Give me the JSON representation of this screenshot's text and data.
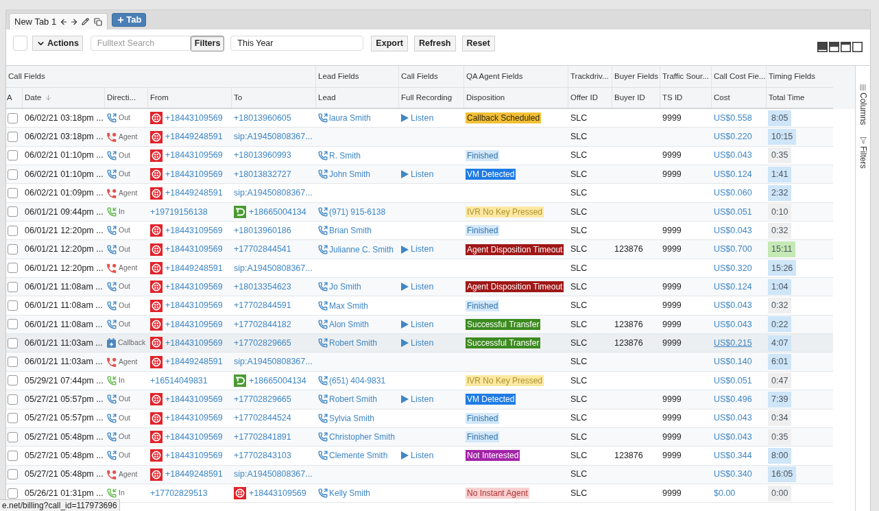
{
  "tabs": [
    {
      "label": "New Tab 1",
      "selected": true
    }
  ],
  "new_tab_button": "Tab",
  "toolbar": {
    "select_all": {
      "checked": false
    },
    "actions_button": "Actions",
    "search": {
      "placeholder": "Fulltext Search"
    },
    "filters_button": {
      "label": "Filters",
      "active": true
    },
    "date_range": {
      "value": "This Year"
    },
    "buttons": [
      "Export",
      "Refresh",
      "Reset"
    ]
  },
  "table": {
    "column_groups": [
      {
        "label": "Call Fields",
        "columns": [
          {
            "label": "A",
            "sorted": false
          },
          {
            "label": "Date",
            "sorted": true
          },
          {
            "label": "Directi...",
            "sorted": false
          },
          {
            "label": "From",
            "sorted": false
          },
          {
            "label": "To",
            "sorted": false
          }
        ]
      },
      {
        "label": "Lead Fields",
        "columns": [
          {
            "label": "Lead",
            "sorted": false
          }
        ]
      },
      {
        "label": "Call Fields",
        "columns": [
          {
            "label": "Full Recording",
            "sorted": false
          }
        ]
      },
      {
        "label": "QA Agent Fields",
        "columns": [
          {
            "label": "Disposition",
            "sorted": false
          }
        ]
      },
      {
        "label": "Trackdriv...",
        "columns": [
          {
            "label": "Offer ID",
            "sorted": false
          }
        ]
      },
      {
        "label": "Buyer Fields",
        "columns": [
          {
            "label": "Buyer ID",
            "sorted": false
          }
        ]
      },
      {
        "label": "Traffic Sour...",
        "columns": [
          {
            "label": "TS ID",
            "sorted": false
          }
        ]
      },
      {
        "label": "Call Cost Fie...",
        "columns": [
          {
            "label": "Cost",
            "sorted": false
          }
        ]
      },
      {
        "label": "Timing Fields",
        "columns": [
          {
            "label": "Total Time",
            "sorted": false
          }
        ]
      }
    ],
    "rows": [
      {
        "selected": false,
        "highlighted": false,
        "date": "06/02/21 03:18pm ...",
        "direction": {
          "kind": "out",
          "label": "Out"
        },
        "from": {
          "kind": "dots",
          "number": "+18443109569"
        },
        "to": {
          "kind": "plain",
          "number": "+18013960605"
        },
        "lead": "laura Smith",
        "recording": "Listen",
        "disposition": {
          "label": "Callback Scheduled",
          "color": "#f2c037"
        },
        "offer_id": "SLC",
        "ts_id": "9999",
        "cost": "US$0.558",
        "total_time": {
          "value": "8:05",
          "color": "#cfe5f8"
        }
      },
      {
        "selected": false,
        "highlighted": false,
        "date": "06/02/21 03:18pm ...",
        "direction": {
          "kind": "agent",
          "label": "Agent"
        },
        "from": {
          "kind": "dots",
          "number": "+18449248591"
        },
        "to": {
          "kind": "plain",
          "number": "sip:A19450808367..."
        },
        "offer_id": "SLC",
        "cost": "US$0.220",
        "total_time": {
          "value": "10:15",
          "color": "#cfe5f8"
        }
      },
      {
        "selected": false,
        "highlighted": false,
        "date": "06/02/21 01:10pm ...",
        "direction": {
          "kind": "out",
          "label": "Out"
        },
        "from": {
          "kind": "dots",
          "number": "+18443109569"
        },
        "to": {
          "kind": "plain",
          "number": "+18013960993"
        },
        "lead": "R. Smith",
        "disposition": {
          "label": "Finished",
          "color": "#d4e8f9"
        },
        "offer_id": "SLC",
        "ts_id": "9999",
        "cost": "US$0.043",
        "total_time": {
          "value": "0:35",
          "color": "#efefef"
        }
      },
      {
        "selected": false,
        "highlighted": false,
        "date": "06/02/21 01:10pm ...",
        "direction": {
          "kind": "out",
          "label": "Out"
        },
        "from": {
          "kind": "dots",
          "number": "+18443109569"
        },
        "to": {
          "kind": "plain",
          "number": "+18013832727"
        },
        "lead": "John Smith",
        "recording": "Listen",
        "disposition": {
          "label": "VM Detected",
          "color": "#1e7be6"
        },
        "offer_id": "SLC",
        "ts_id": "9999",
        "cost": "US$0.124",
        "total_time": {
          "value": "1:41",
          "color": "#cfe5f8"
        }
      },
      {
        "selected": false,
        "highlighted": false,
        "date": "06/02/21 01:09pm ...",
        "direction": {
          "kind": "agent",
          "label": "Agent"
        },
        "from": {
          "kind": "dots",
          "number": "+18449248591"
        },
        "to": {
          "kind": "plain",
          "number": "sip:A19450808367..."
        },
        "offer_id": "SLC",
        "cost": "US$0.060",
        "total_time": {
          "value": "2:32",
          "color": "#cfe5f8"
        }
      },
      {
        "selected": false,
        "highlighted": false,
        "date": "06/01/21 09:44pm ...",
        "direction": {
          "kind": "in",
          "label": "In"
        },
        "from": {
          "kind": "plain",
          "number": "+19719156138"
        },
        "to": {
          "kind": "arc",
          "number": "+18665004134"
        },
        "lead": "(971) 915-6138",
        "disposition": {
          "label": "IVR No Key Pressed",
          "color": "#fce8a1"
        },
        "offer_id": "SLC",
        "cost": "US$0.051",
        "total_time": {
          "value": "0:10",
          "color": "#efefef"
        }
      },
      {
        "selected": false,
        "highlighted": false,
        "date": "06/01/21 12:20pm ...",
        "direction": {
          "kind": "out",
          "label": "Out"
        },
        "from": {
          "kind": "dots",
          "number": "+18443109569"
        },
        "to": {
          "kind": "plain",
          "number": "+18013960186"
        },
        "lead": "Brian Smith",
        "disposition": {
          "label": "Finished",
          "color": "#d4e8f9"
        },
        "offer_id": "SLC",
        "ts_id": "9999",
        "cost": "US$0.043",
        "total_time": {
          "value": "0:32",
          "color": "#efefef"
        }
      },
      {
        "selected": false,
        "highlighted": false,
        "date": "06/01/21 12:20pm ...",
        "direction": {
          "kind": "out",
          "label": "Out"
        },
        "from": {
          "kind": "dots",
          "number": "+18443109569"
        },
        "to": {
          "kind": "plain",
          "number": "+17702844541"
        },
        "lead": "Julianne C. Smith",
        "recording": "Listen",
        "disposition": {
          "label": "Agent Disposition Timeout",
          "color": "#a01717"
        },
        "offer_id": "SLC",
        "buyer_id": "123876",
        "ts_id": "9999",
        "cost": "US$0.700",
        "total_time": {
          "value": "15:11",
          "color": "#c5e9b5"
        }
      },
      {
        "selected": false,
        "highlighted": false,
        "date": "06/01/21 12:20pm ...",
        "direction": {
          "kind": "agent",
          "label": "Agent"
        },
        "from": {
          "kind": "dots",
          "number": "+18449248591"
        },
        "to": {
          "kind": "plain",
          "number": "sip:A19450808367..."
        },
        "offer_id": "SLC",
        "cost": "US$0.320",
        "total_time": {
          "value": "15:26",
          "color": "#cfe5f8"
        }
      },
      {
        "selected": false,
        "highlighted": false,
        "date": "06/01/21 11:08am ...",
        "direction": {
          "kind": "out",
          "label": "Out"
        },
        "from": {
          "kind": "dots",
          "number": "+18443109569"
        },
        "to": {
          "kind": "plain",
          "number": "+18013354623"
        },
        "lead": "Jo Smith",
        "recording": "Listen",
        "disposition": {
          "label": "Agent Disposition Timeout",
          "color": "#a01717"
        },
        "offer_id": "SLC",
        "ts_id": "9999",
        "cost": "US$0.124",
        "total_time": {
          "value": "1:04",
          "color": "#cfe5f8"
        }
      },
      {
        "selected": false,
        "highlighted": false,
        "date": "06/01/21 11:08am ...",
        "direction": {
          "kind": "out",
          "label": "Out"
        },
        "from": {
          "kind": "dots",
          "number": "+18443109569"
        },
        "to": {
          "kind": "plain",
          "number": "+17702844591"
        },
        "lead": "Max Smith",
        "disposition": {
          "label": "Finished",
          "color": "#d4e8f9"
        },
        "offer_id": "SLC",
        "ts_id": "9999",
        "cost": "US$0.043",
        "total_time": {
          "value": "0:32",
          "color": "#efefef"
        }
      },
      {
        "selected": false,
        "highlighted": false,
        "date": "06/01/21 11:08am ...",
        "direction": {
          "kind": "out",
          "label": "Out"
        },
        "from": {
          "kind": "dots",
          "number": "+18443109569"
        },
        "to": {
          "kind": "plain",
          "number": "+17702844182"
        },
        "lead": "Alon Smith",
        "recording": "Listen",
        "disposition": {
          "label": "Successful Transfer",
          "color": "#3c8a1f"
        },
        "offer_id": "SLC",
        "buyer_id": "123876",
        "ts_id": "9999",
        "cost": "US$0.043",
        "total_time": {
          "value": "0:22",
          "color": "#cfe5f8"
        }
      },
      {
        "selected": false,
        "highlighted": true,
        "date": "06/01/21 11:03am ...",
        "direction": {
          "kind": "callback",
          "label": "Callback"
        },
        "from": {
          "kind": "dots",
          "number": "+18443109569"
        },
        "to": {
          "kind": "plain",
          "number": "+17702829665"
        },
        "lead": "Robert Smith",
        "recording": "Listen",
        "disposition": {
          "label": "Successful Transfer",
          "color": "#3c8a1f"
        },
        "offer_id": "SLC",
        "buyer_id": "123876",
        "ts_id": "9999",
        "cost": "US$0.215",
        "total_time": {
          "value": "4:07",
          "color": "#cfe5f8"
        }
      },
      {
        "selected": false,
        "highlighted": false,
        "date": "06/01/21 11:03am ...",
        "direction": {
          "kind": "agent",
          "label": "Agent"
        },
        "from": {
          "kind": "dots",
          "number": "+18449248591"
        },
        "to": {
          "kind": "plain",
          "number": "sip:A19450808367..."
        },
        "offer_id": "SLC",
        "cost": "US$0.140",
        "total_time": {
          "value": "6:01",
          "color": "#cfe5f8"
        }
      },
      {
        "selected": false,
        "highlighted": false,
        "date": "05/29/21 07:44pm ...",
        "direction": {
          "kind": "in",
          "label": "In"
        },
        "from": {
          "kind": "plain",
          "number": "+16514049831"
        },
        "to": {
          "kind": "arc",
          "number": "+18665004134"
        },
        "lead": "(651) 404-9831",
        "disposition": {
          "label": "IVR No Key Pressed",
          "color": "#fce8a1"
        },
        "offer_id": "SLC",
        "cost": "US$0.051",
        "total_time": {
          "value": "0:47",
          "color": "#efefef"
        }
      },
      {
        "selected": false,
        "highlighted": false,
        "date": "05/27/21 05:57pm ...",
        "direction": {
          "kind": "out",
          "label": "Out"
        },
        "from": {
          "kind": "dots",
          "number": "+18443109569"
        },
        "to": {
          "kind": "plain",
          "number": "+17702829665"
        },
        "lead": "Robert Smith",
        "recording": "Listen",
        "disposition": {
          "label": "VM Detected",
          "color": "#1e7be6"
        },
        "offer_id": "SLC",
        "ts_id": "9999",
        "cost": "US$0.496",
        "total_time": {
          "value": "7:39",
          "color": "#cfe5f8"
        }
      },
      {
        "selected": false,
        "highlighted": false,
        "date": "05/27/21 05:57pm ...",
        "direction": {
          "kind": "out",
          "label": "Out"
        },
        "from": {
          "kind": "dots",
          "number": "+18443109569"
        },
        "to": {
          "kind": "plain",
          "number": "+17702844524"
        },
        "lead": "Sylvia Smith",
        "disposition": {
          "label": "Finished",
          "color": "#d4e8f9"
        },
        "offer_id": "SLC",
        "ts_id": "9999",
        "cost": "US$0.043",
        "total_time": {
          "value": "0:34",
          "color": "#efefef"
        }
      },
      {
        "selected": false,
        "highlighted": false,
        "date": "05/27/21 05:48pm ...",
        "direction": {
          "kind": "out",
          "label": "Out"
        },
        "from": {
          "kind": "dots",
          "number": "+18443109569"
        },
        "to": {
          "kind": "plain",
          "number": "+17702841891"
        },
        "lead": "Christopher Smith",
        "disposition": {
          "label": "Finished",
          "color": "#d4e8f9"
        },
        "offer_id": "SLC",
        "ts_id": "9999",
        "cost": "US$0.043",
        "total_time": {
          "value": "0:35",
          "color": "#efefef"
        }
      },
      {
        "selected": false,
        "highlighted": false,
        "date": "05/27/21 05:48pm ...",
        "direction": {
          "kind": "out",
          "label": "Out"
        },
        "from": {
          "kind": "dots",
          "number": "+18443109569"
        },
        "to": {
          "kind": "plain",
          "number": "+17702843103"
        },
        "lead": "Clemente Smith",
        "recording": "Listen",
        "disposition": {
          "label": "Not Interested",
          "color": "#a324a8"
        },
        "offer_id": "SLC",
        "buyer_id": "123876",
        "ts_id": "9999",
        "cost": "US$0.344",
        "total_time": {
          "value": "8:00",
          "color": "#cfe5f8"
        }
      },
      {
        "selected": false,
        "highlighted": false,
        "date": "05/27/21 05:48pm ...",
        "direction": {
          "kind": "agent",
          "label": "Agent"
        },
        "from": {
          "kind": "dots",
          "number": "+18449248591"
        },
        "to": {
          "kind": "plain",
          "number": "sip:A19450808367..."
        },
        "offer_id": "SLC",
        "cost": "US$0.340",
        "total_time": {
          "value": "16:05",
          "color": "#cfe5f8"
        }
      },
      {
        "selected": false,
        "highlighted": false,
        "date": "05/26/21 01:31pm ...",
        "direction": {
          "kind": "in",
          "label": "In"
        },
        "from": {
          "kind": "plain",
          "number": "+17702829513"
        },
        "to": {
          "kind": "dots",
          "number": "+18443109569"
        },
        "lead": "Kelly Smith",
        "disposition": {
          "label": "No Instant Agent",
          "color": "#f8d0d0"
        },
        "offer_id": "SLC",
        "ts_id": "9999",
        "cost": "$0.00",
        "total_time": {
          "value": "0:00",
          "color": "#efefef"
        }
      }
    ]
  },
  "side_panel": {
    "tabs": [
      "Columns",
      "Filters"
    ]
  },
  "status_url": "e.net/billing?call_id=117973696"
}
